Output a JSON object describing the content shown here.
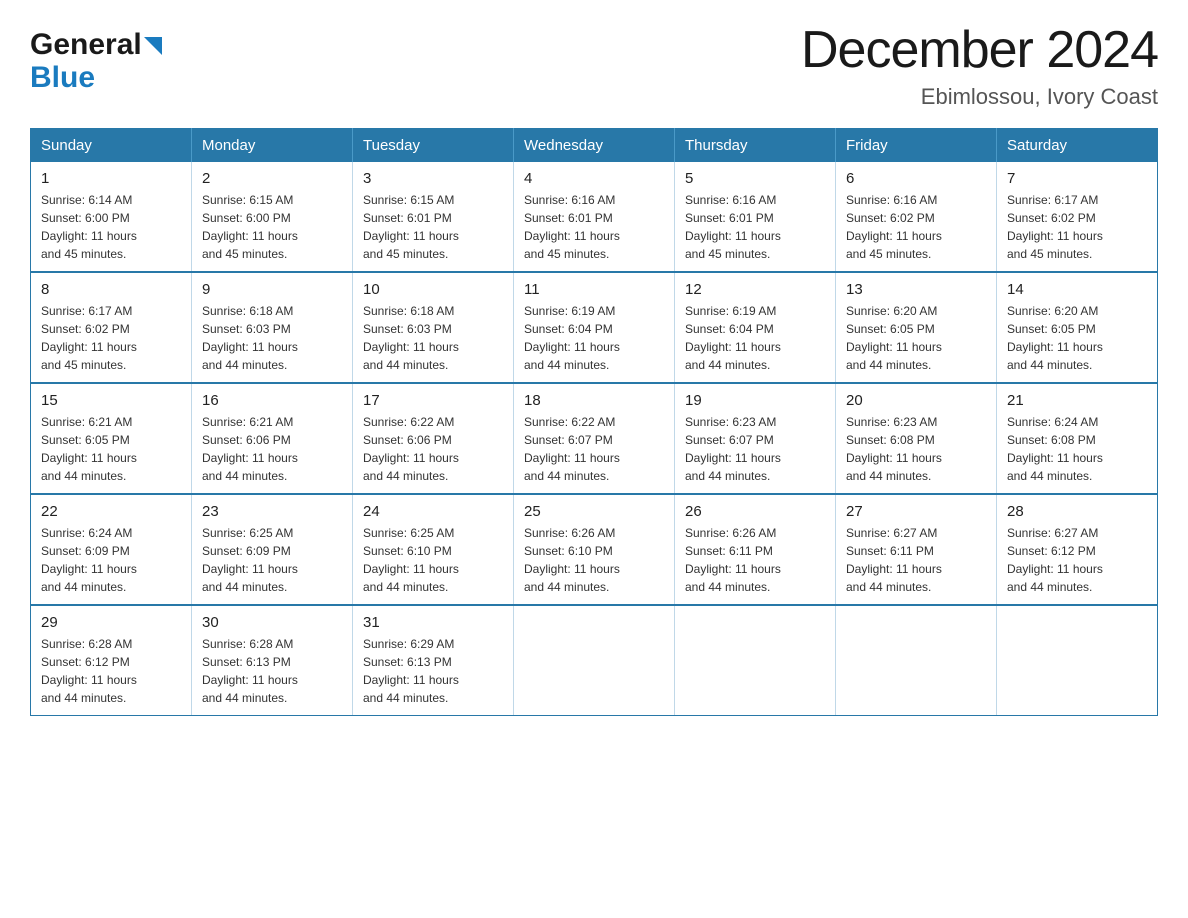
{
  "logo": {
    "general": "General",
    "blue": "Blue"
  },
  "header": {
    "title": "December 2024",
    "subtitle": "Ebimlossou, Ivory Coast"
  },
  "days_of_week": [
    "Sunday",
    "Monday",
    "Tuesday",
    "Wednesday",
    "Thursday",
    "Friday",
    "Saturday"
  ],
  "weeks": [
    [
      {
        "day": "1",
        "sunrise": "6:14 AM",
        "sunset": "6:00 PM",
        "daylight": "11 hours and 45 minutes."
      },
      {
        "day": "2",
        "sunrise": "6:15 AM",
        "sunset": "6:00 PM",
        "daylight": "11 hours and 45 minutes."
      },
      {
        "day": "3",
        "sunrise": "6:15 AM",
        "sunset": "6:01 PM",
        "daylight": "11 hours and 45 minutes."
      },
      {
        "day": "4",
        "sunrise": "6:16 AM",
        "sunset": "6:01 PM",
        "daylight": "11 hours and 45 minutes."
      },
      {
        "day": "5",
        "sunrise": "6:16 AM",
        "sunset": "6:01 PM",
        "daylight": "11 hours and 45 minutes."
      },
      {
        "day": "6",
        "sunrise": "6:16 AM",
        "sunset": "6:02 PM",
        "daylight": "11 hours and 45 minutes."
      },
      {
        "day": "7",
        "sunrise": "6:17 AM",
        "sunset": "6:02 PM",
        "daylight": "11 hours and 45 minutes."
      }
    ],
    [
      {
        "day": "8",
        "sunrise": "6:17 AM",
        "sunset": "6:02 PM",
        "daylight": "11 hours and 45 minutes."
      },
      {
        "day": "9",
        "sunrise": "6:18 AM",
        "sunset": "6:03 PM",
        "daylight": "11 hours and 44 minutes."
      },
      {
        "day": "10",
        "sunrise": "6:18 AM",
        "sunset": "6:03 PM",
        "daylight": "11 hours and 44 minutes."
      },
      {
        "day": "11",
        "sunrise": "6:19 AM",
        "sunset": "6:04 PM",
        "daylight": "11 hours and 44 minutes."
      },
      {
        "day": "12",
        "sunrise": "6:19 AM",
        "sunset": "6:04 PM",
        "daylight": "11 hours and 44 minutes."
      },
      {
        "day": "13",
        "sunrise": "6:20 AM",
        "sunset": "6:05 PM",
        "daylight": "11 hours and 44 minutes."
      },
      {
        "day": "14",
        "sunrise": "6:20 AM",
        "sunset": "6:05 PM",
        "daylight": "11 hours and 44 minutes."
      }
    ],
    [
      {
        "day": "15",
        "sunrise": "6:21 AM",
        "sunset": "6:05 PM",
        "daylight": "11 hours and 44 minutes."
      },
      {
        "day": "16",
        "sunrise": "6:21 AM",
        "sunset": "6:06 PM",
        "daylight": "11 hours and 44 minutes."
      },
      {
        "day": "17",
        "sunrise": "6:22 AM",
        "sunset": "6:06 PM",
        "daylight": "11 hours and 44 minutes."
      },
      {
        "day": "18",
        "sunrise": "6:22 AM",
        "sunset": "6:07 PM",
        "daylight": "11 hours and 44 minutes."
      },
      {
        "day": "19",
        "sunrise": "6:23 AM",
        "sunset": "6:07 PM",
        "daylight": "11 hours and 44 minutes."
      },
      {
        "day": "20",
        "sunrise": "6:23 AM",
        "sunset": "6:08 PM",
        "daylight": "11 hours and 44 minutes."
      },
      {
        "day": "21",
        "sunrise": "6:24 AM",
        "sunset": "6:08 PM",
        "daylight": "11 hours and 44 minutes."
      }
    ],
    [
      {
        "day": "22",
        "sunrise": "6:24 AM",
        "sunset": "6:09 PM",
        "daylight": "11 hours and 44 minutes."
      },
      {
        "day": "23",
        "sunrise": "6:25 AM",
        "sunset": "6:09 PM",
        "daylight": "11 hours and 44 minutes."
      },
      {
        "day": "24",
        "sunrise": "6:25 AM",
        "sunset": "6:10 PM",
        "daylight": "11 hours and 44 minutes."
      },
      {
        "day": "25",
        "sunrise": "6:26 AM",
        "sunset": "6:10 PM",
        "daylight": "11 hours and 44 minutes."
      },
      {
        "day": "26",
        "sunrise": "6:26 AM",
        "sunset": "6:11 PM",
        "daylight": "11 hours and 44 minutes."
      },
      {
        "day": "27",
        "sunrise": "6:27 AM",
        "sunset": "6:11 PM",
        "daylight": "11 hours and 44 minutes."
      },
      {
        "day": "28",
        "sunrise": "6:27 AM",
        "sunset": "6:12 PM",
        "daylight": "11 hours and 44 minutes."
      }
    ],
    [
      {
        "day": "29",
        "sunrise": "6:28 AM",
        "sunset": "6:12 PM",
        "daylight": "11 hours and 44 minutes."
      },
      {
        "day": "30",
        "sunrise": "6:28 AM",
        "sunset": "6:13 PM",
        "daylight": "11 hours and 44 minutes."
      },
      {
        "day": "31",
        "sunrise": "6:29 AM",
        "sunset": "6:13 PM",
        "daylight": "11 hours and 44 minutes."
      },
      null,
      null,
      null,
      null
    ]
  ],
  "label_sunrise": "Sunrise:",
  "label_sunset": "Sunset:",
  "label_daylight": "Daylight:"
}
